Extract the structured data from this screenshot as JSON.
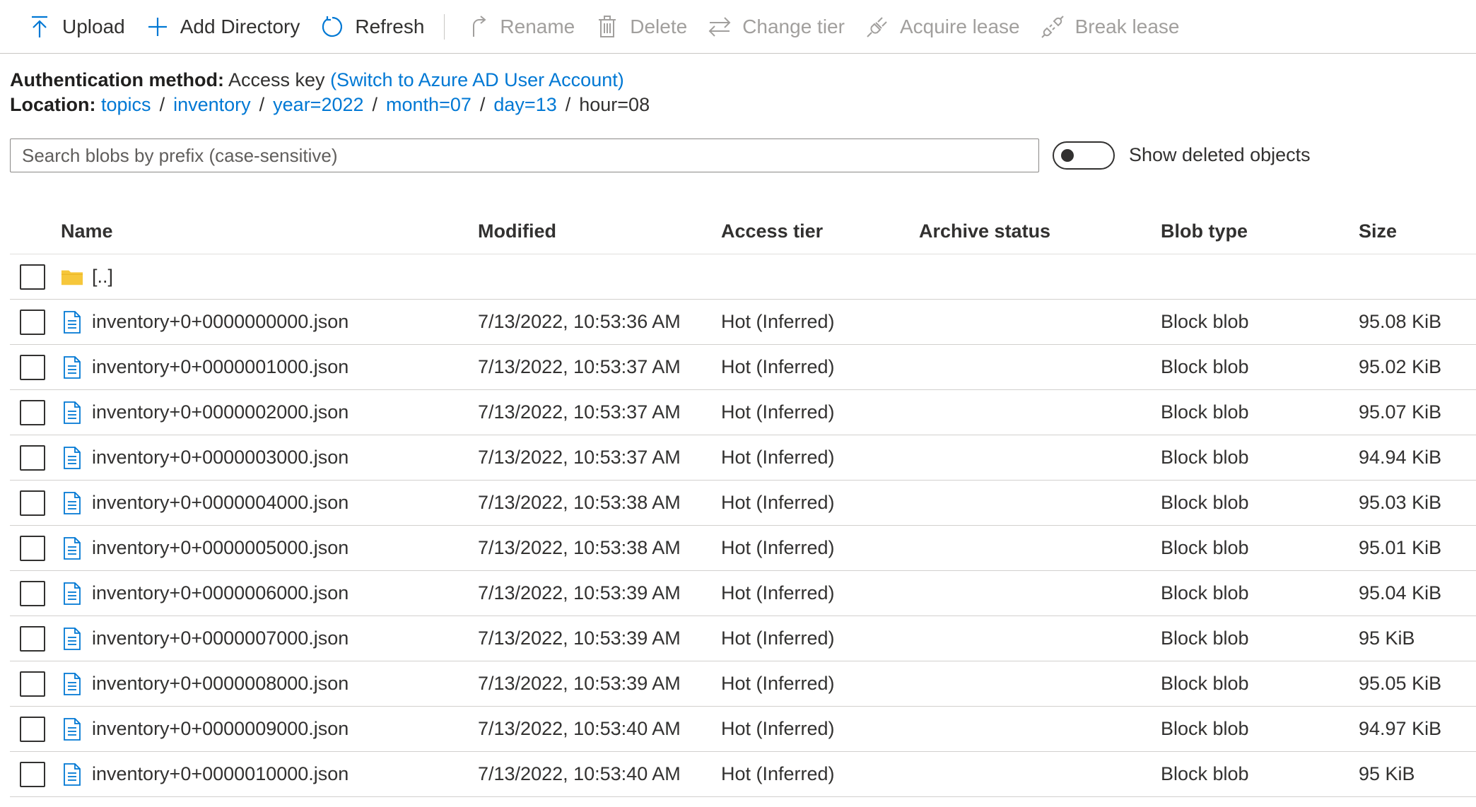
{
  "toolbar": {
    "items": [
      {
        "label": "Upload",
        "icon": "upload-icon",
        "enabled": true
      },
      {
        "label": "Add Directory",
        "icon": "plus-icon",
        "enabled": true
      },
      {
        "label": "Refresh",
        "icon": "refresh-icon",
        "enabled": true
      },
      {
        "label": "Rename",
        "icon": "rename-icon",
        "enabled": false
      },
      {
        "label": "Delete",
        "icon": "trash-icon",
        "enabled": false
      },
      {
        "label": "Change tier",
        "icon": "swap-arrows-icon",
        "enabled": false
      },
      {
        "label": "Acquire lease",
        "icon": "plug-icon",
        "enabled": false
      },
      {
        "label": "Break lease",
        "icon": "unplug-icon",
        "enabled": false
      }
    ]
  },
  "auth": {
    "label": "Authentication method:",
    "value": "Access key",
    "switch_link": "(Switch to Azure AD User Account)"
  },
  "location": {
    "label": "Location:",
    "crumbs": [
      "topics",
      "inventory",
      "year=2022",
      "month=07",
      "day=13"
    ],
    "current": "hour=08",
    "separator": "/"
  },
  "search": {
    "placeholder": "Search blobs by prefix (case-sensitive)",
    "value": ""
  },
  "show_deleted": {
    "label": "Show deleted objects",
    "on": false
  },
  "table": {
    "headers": {
      "name": "Name",
      "modified": "Modified",
      "tier": "Access tier",
      "archive": "Archive status",
      "type": "Blob type",
      "size": "Size"
    },
    "parent_dir": "[..]",
    "rows": [
      {
        "name": "inventory+0+0000000000.json",
        "modified": "7/13/2022, 10:53:36 AM",
        "tier": "Hot (Inferred)",
        "archive": "",
        "type": "Block blob",
        "size": "95.08 KiB"
      },
      {
        "name": "inventory+0+0000001000.json",
        "modified": "7/13/2022, 10:53:37 AM",
        "tier": "Hot (Inferred)",
        "archive": "",
        "type": "Block blob",
        "size": "95.02 KiB"
      },
      {
        "name": "inventory+0+0000002000.json",
        "modified": "7/13/2022, 10:53:37 AM",
        "tier": "Hot (Inferred)",
        "archive": "",
        "type": "Block blob",
        "size": "95.07 KiB"
      },
      {
        "name": "inventory+0+0000003000.json",
        "modified": "7/13/2022, 10:53:37 AM",
        "tier": "Hot (Inferred)",
        "archive": "",
        "type": "Block blob",
        "size": "94.94 KiB"
      },
      {
        "name": "inventory+0+0000004000.json",
        "modified": "7/13/2022, 10:53:38 AM",
        "tier": "Hot (Inferred)",
        "archive": "",
        "type": "Block blob",
        "size": "95.03 KiB"
      },
      {
        "name": "inventory+0+0000005000.json",
        "modified": "7/13/2022, 10:53:38 AM",
        "tier": "Hot (Inferred)",
        "archive": "",
        "type": "Block blob",
        "size": "95.01 KiB"
      },
      {
        "name": "inventory+0+0000006000.json",
        "modified": "7/13/2022, 10:53:39 AM",
        "tier": "Hot (Inferred)",
        "archive": "",
        "type": "Block blob",
        "size": "95.04 KiB"
      },
      {
        "name": "inventory+0+0000007000.json",
        "modified": "7/13/2022, 10:53:39 AM",
        "tier": "Hot (Inferred)",
        "archive": "",
        "type": "Block blob",
        "size": "95 KiB"
      },
      {
        "name": "inventory+0+0000008000.json",
        "modified": "7/13/2022, 10:53:39 AM",
        "tier": "Hot (Inferred)",
        "archive": "",
        "type": "Block blob",
        "size": "95.05 KiB"
      },
      {
        "name": "inventory+0+0000009000.json",
        "modified": "7/13/2022, 10:53:40 AM",
        "tier": "Hot (Inferred)",
        "archive": "",
        "type": "Block blob",
        "size": "94.97 KiB"
      },
      {
        "name": "inventory+0+0000010000.json",
        "modified": "7/13/2022, 10:53:40 AM",
        "tier": "Hot (Inferred)",
        "archive": "",
        "type": "Block blob",
        "size": "95 KiB"
      }
    ]
  },
  "colors": {
    "accent": "#0078d4",
    "disabled": "#a19f9d",
    "folder": "#f6c73b"
  }
}
